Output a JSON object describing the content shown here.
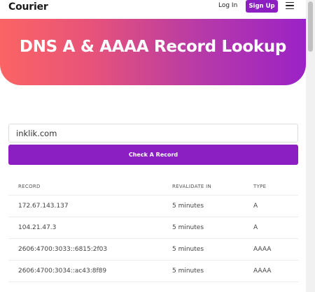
{
  "header": {
    "logo": "Courier",
    "login_label": "Log In",
    "signup_label": "Sign Up",
    "menu_icon": "hamburger-menu-icon"
  },
  "hero": {
    "title": "DNS A & AAAA Record Lookup"
  },
  "form": {
    "domain_value": "inklik.com",
    "button_label": "Check A Record"
  },
  "table": {
    "columns": [
      "RECORD",
      "REVALIDATE IN",
      "TYPE"
    ],
    "rows": [
      [
        "172.67.143.137",
        "5 minutes",
        "A"
      ],
      [
        "104.21.47.3",
        "5 minutes",
        "A"
      ],
      [
        "2606:4700:3033::6815:2f03",
        "5 minutes",
        "AAAA"
      ],
      [
        "2606:4700:3034::ac43:8f89",
        "5 minutes",
        "AAAA"
      ]
    ]
  },
  "colors": {
    "brand": "#8b1fc1",
    "hero_gradient_start": "#fb6464",
    "hero_gradient_end": "#9b22c6"
  }
}
